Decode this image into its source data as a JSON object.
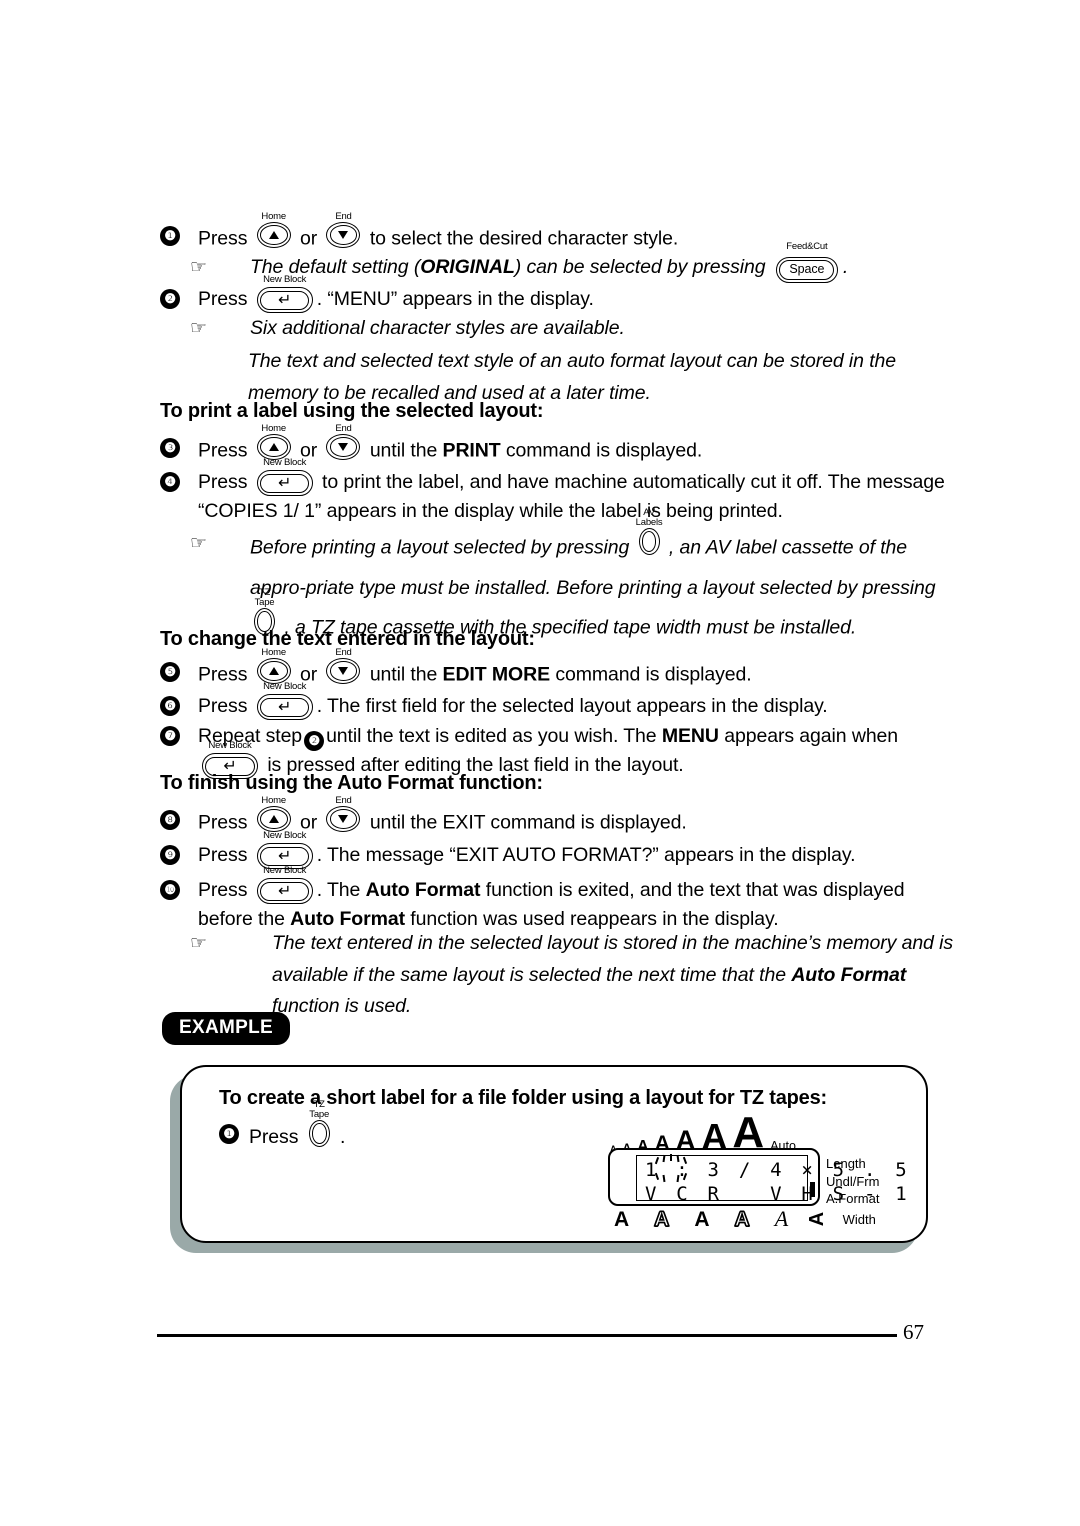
{
  "page": {
    "number": "67"
  },
  "keys": {
    "home_label": "Home",
    "end_label": "End",
    "new_block_label": "New Block",
    "feed_cut_label": "Feed&Cut",
    "space_label": "Space",
    "enter_glyph": "↵",
    "av_labels_label": "AV\nLabels",
    "av_labels_line1": "AV",
    "av_labels_line2": "Labels",
    "tz_tape_line1": "TZ",
    "tz_tape_line2": "Tape",
    "hand_glyph": "☞"
  },
  "steps": {
    "s7": {
      "num": "❶",
      "t1": "Press",
      "t2": "or",
      "t3": "to select the desired character style."
    },
    "n7": {
      "t1": "The default setting (",
      "bold": "ORIGINAL",
      "t2": ") can be selected by pressing",
      "t3": "."
    },
    "s8": {
      "num": "❷",
      "t1": "Press",
      "t2": ". “MENU” appears in the display."
    },
    "n8": {
      "t1": "Six additional character styles are available."
    },
    "n8b": {
      "t1": "The text and selected text style of an auto format layout can be stored in the memory to be recalled and used at a later time."
    },
    "head_print": "To print a label using the selected layout:",
    "s9": {
      "num": "❸",
      "t1": "Press",
      "t2": "or",
      "t3": "until the",
      "bold": "PRINT",
      "t4": "command is displayed."
    },
    "s10": {
      "num": "❹",
      "t1": "Press",
      "t2": "to print the label, and have machine automatically cut it off. The message “COPIES 1/ 1” appears in the display while the label is being printed."
    },
    "n10": {
      "t1": "Before printing a layout selected by pressing",
      "t2": ", an AV label cassette of the appro-priate type must be installed. Before printing a layout selected by pressing",
      "t3": ", a TZ tape cassette with the specified tape width must be installed."
    },
    "head_change": "To change the text entered in the layout:",
    "s11": {
      "num": "❺",
      "t1": "Press",
      "t2": "or",
      "t3": "until the",
      "bold": "EDIT MORE",
      "t4": "command is displayed."
    },
    "s12": {
      "num": "❻",
      "t1": "Press",
      "t2": ". The first field for the selected layout appears in the display."
    },
    "s13": {
      "num": "❼",
      "t1": "Repeat step",
      "inline_num": "❷",
      "t2": "until the text is edited as you wish. The",
      "bold": "MENU",
      "t3": "appears again when",
      "t4": "is pressed after editing the last field in the layout."
    },
    "head_finish": "To finish using the Auto Format function:",
    "s14": {
      "num": "❽",
      "t1": "Press",
      "t2": "or",
      "t3": "until the EXIT command is displayed."
    },
    "s15": {
      "num": "❾",
      "t1": "Press",
      "t2": ". The message “EXIT AUTO FORMAT?” appears in the display."
    },
    "s16": {
      "num": "❿",
      "t1": "Press",
      "t2": ". The",
      "bold1": "Auto Format",
      "t3": "function is exited, and the text that was displayed before the",
      "bold2": "Auto Format",
      "t4": "function was used reappears in the display."
    },
    "n16": {
      "t1": "The text entered in the selected layout is stored in the machine’s memory and is available if the same layout is selected the next time that the",
      "bold": "Auto Format",
      "t2": "function is used."
    }
  },
  "example": {
    "badge": "EXAMPLE",
    "title": "To create a short label for a file folder using a layout for TZ tapes:",
    "step1": {
      "num": "❶",
      "t1": "Press",
      "t2": "."
    }
  },
  "lcd": {
    "size_indicators": [
      "A",
      "A",
      "A",
      "A",
      "A",
      "A",
      "A"
    ],
    "auto_label": "Auto",
    "line1": "1 : 3 / 4 × 5 . 5",
    "line2": "V C R   V H S - 1",
    "right_labels": [
      "Length",
      "Undl/Frm",
      "A.Format"
    ],
    "width_label": "Width",
    "width_indicators": [
      "A",
      "A",
      "A",
      "A",
      "A",
      "A"
    ]
  },
  "colors": {
    "ink": "#000000",
    "paper": "#ffffff",
    "shadow": "#9aa9a8"
  }
}
